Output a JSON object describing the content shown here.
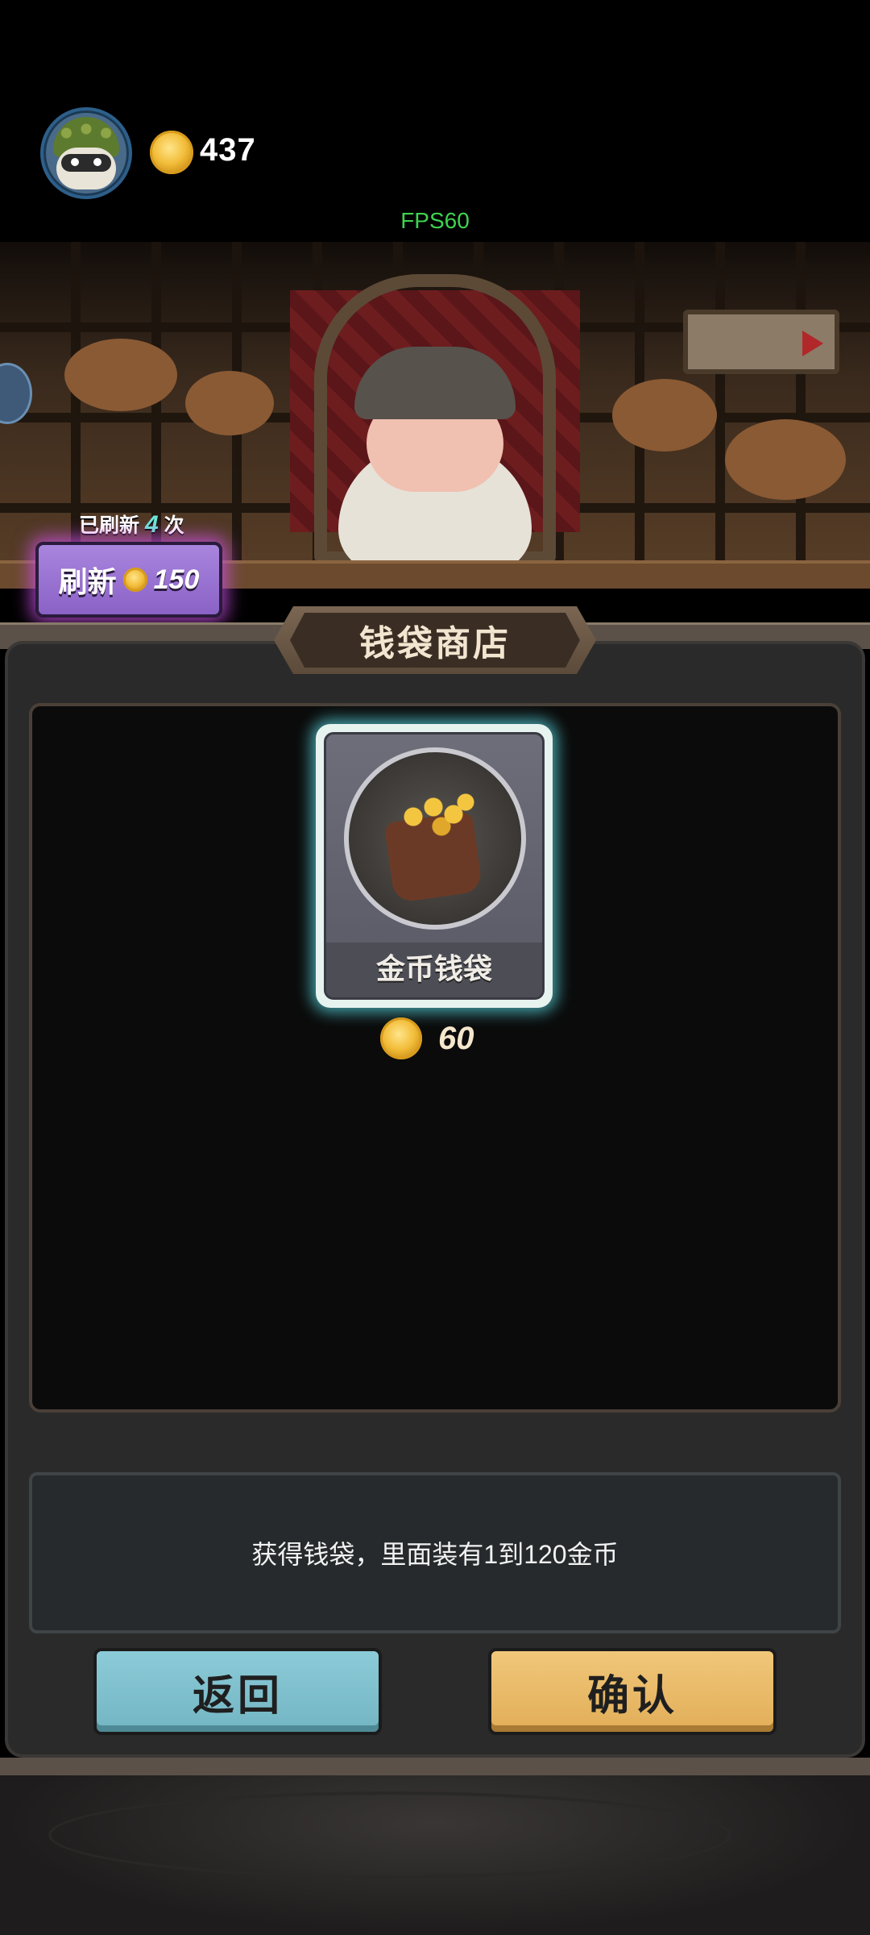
{
  "player": {
    "avatar_icon": "raccoon-avatar-icon",
    "gold": "437"
  },
  "debug": {
    "fps": "FPS60"
  },
  "refresh": {
    "count_prefix": "已刷新",
    "count": "4",
    "count_suffix": "次",
    "button_label": "刷新",
    "cost": "150"
  },
  "shop": {
    "title": "钱袋商店",
    "items": [
      {
        "name": "金币钱袋",
        "price": "60",
        "icon": "coin-bag-icon",
        "selected": true
      }
    ],
    "description": "获得钱袋，里面装有1到120金币"
  },
  "buttons": {
    "back": "返回",
    "confirm": "确认"
  },
  "colors": {
    "gold": "#f2bd3a",
    "refresh_button": "#8a62c6",
    "back_button": "#7fc0cd",
    "confirm_button": "#e8b965",
    "selected_glow": "#5adce6"
  }
}
